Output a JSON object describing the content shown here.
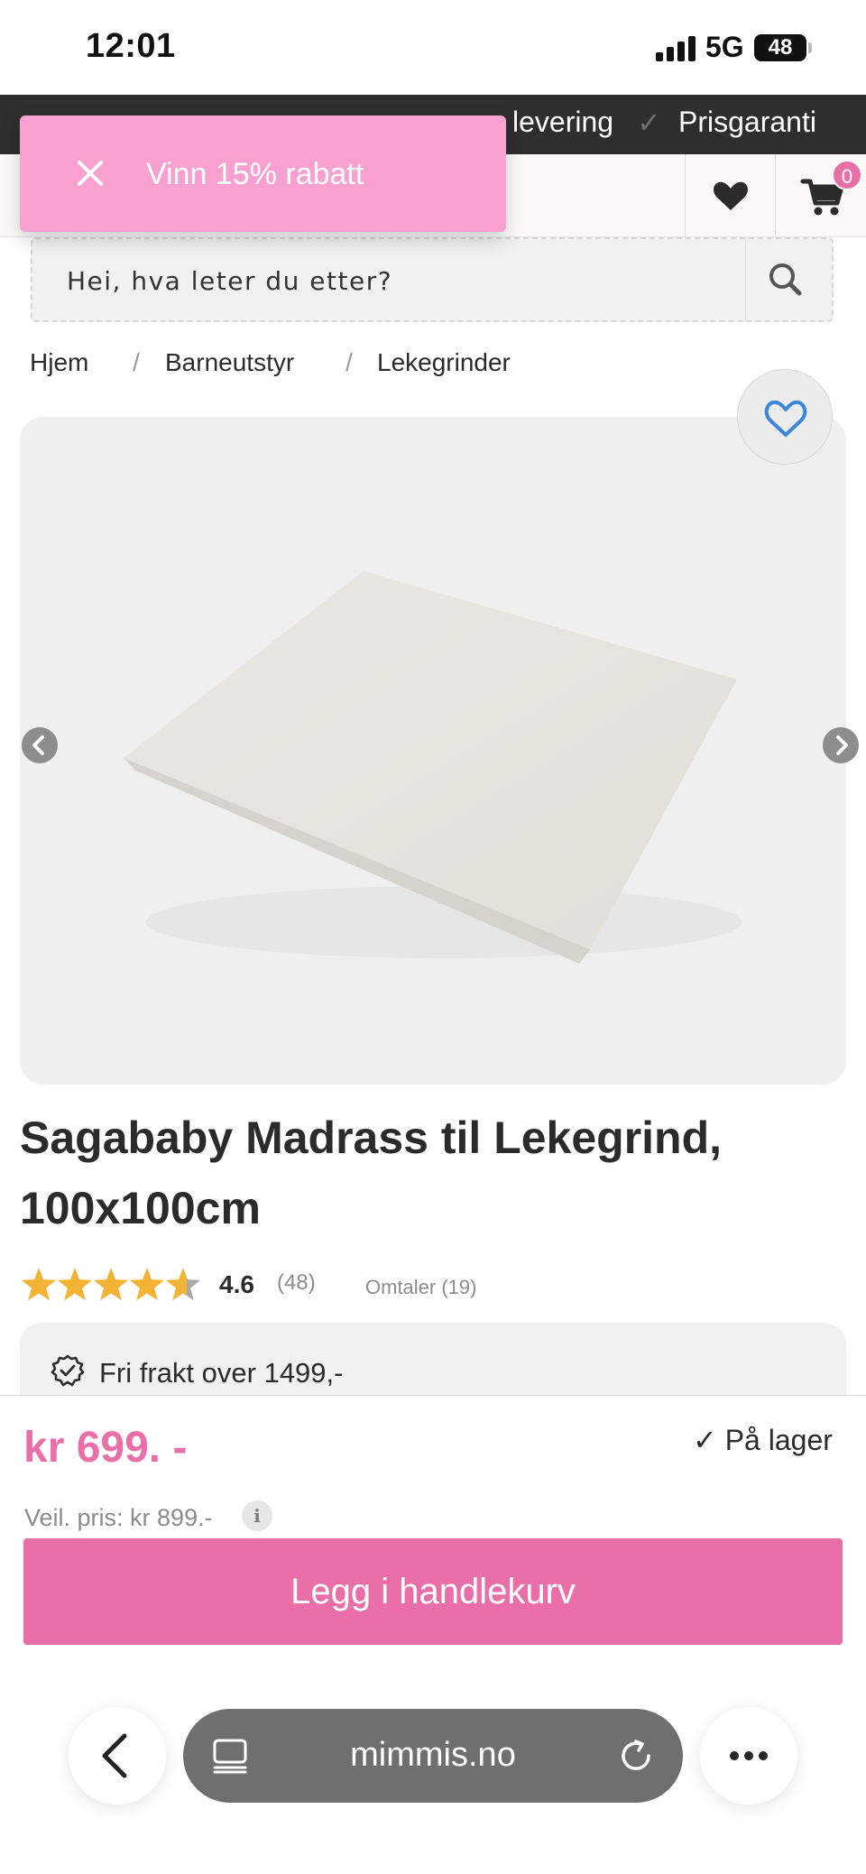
{
  "status_bar": {
    "time": "12:01",
    "network": "5G",
    "battery": "48"
  },
  "usp_bar": {
    "items": [
      "levering",
      "Prisgaranti"
    ],
    "check_glyph": "✓"
  },
  "header": {
    "cart_count": "0"
  },
  "promo": {
    "text": "Vinn 15% rabatt"
  },
  "search": {
    "placeholder": "Hei, hva leter du etter?"
  },
  "breadcrumb": {
    "items": [
      "Hjem",
      "Barneutstyr",
      "Lekegrinder"
    ],
    "separator": "/"
  },
  "product": {
    "title_line1": "Sagababy Madrass til Lekegrind,",
    "title_line2": "100x100cm",
    "rating_value": "4.6",
    "rating_fraction": 0.92,
    "rating_count": "(48)",
    "reviews_link": "Omtaler (19)",
    "shipping_note": "Fri frakt over 1499,-"
  },
  "buy_bar": {
    "price": "kr 699. -",
    "stock": "✓ På lager",
    "rrp": "Veil. pris: kr 899.-",
    "info_glyph": "i",
    "add_to_cart": "Legg i handlekurv"
  },
  "browser": {
    "url": "mimmis.no"
  },
  "colors": {
    "accent_pink": "#ea6fa9",
    "promo_pink": "#f8a1d1",
    "star_gold": "#f5b335",
    "usp_bar_bg": "#2e2e2e"
  },
  "icons": {
    "wishlist": "heart-icon",
    "cart": "cart-icon",
    "search": "search-icon",
    "close": "close-icon",
    "favorite": "heart-outline-icon",
    "prev": "chevron-left-icon",
    "next": "chevron-right-icon",
    "shipping": "badge-check-icon",
    "info": "info-icon",
    "back": "back-icon",
    "tabs": "tabs-icon",
    "reload": "reload-icon",
    "more": "more-icon"
  }
}
